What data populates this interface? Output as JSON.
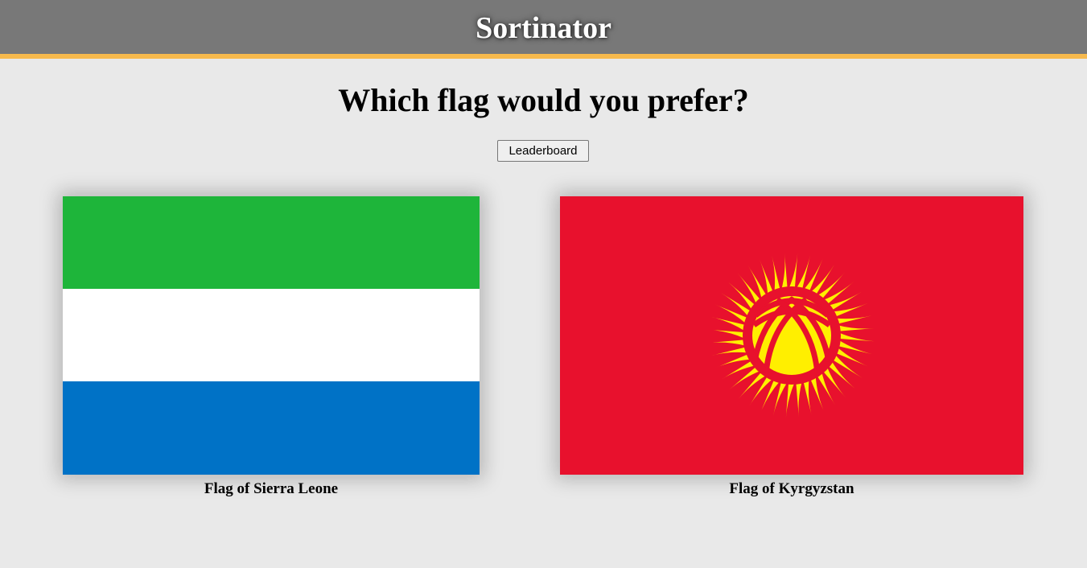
{
  "header": {
    "title": "Sortinator"
  },
  "main": {
    "question": "Which flag would you prefer?",
    "leaderboard_label": "Leaderboard",
    "flags": [
      {
        "caption": "Flag of Sierra Leone",
        "colors": [
          "#1eb53a",
          "#ffffff",
          "#0072c6"
        ]
      },
      {
        "caption": "Flag of Kyrgyzstan",
        "colors": [
          "#e8112d",
          "#ffef00"
        ]
      }
    ]
  },
  "colors": {
    "header_bg": "#787878",
    "header_accent": "#f6b94d",
    "page_bg": "#e9e9e9"
  }
}
